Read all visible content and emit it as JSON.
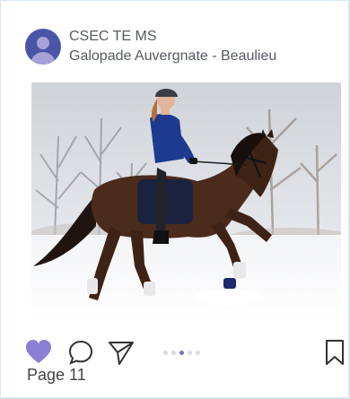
{
  "post": {
    "author": "CSEC TE MS",
    "subtitle": "Galopade Auvergnate - Beaulieu",
    "image_alt": "Rider on a bay horse trotting through snow"
  },
  "actions": {
    "like_icon": "heart-icon",
    "comment_icon": "comment-icon",
    "share_icon": "send-icon",
    "save_icon": "bookmark-icon",
    "carousel_total": 5,
    "carousel_active": 3
  },
  "footer": {
    "page_label": "Page 11"
  },
  "colors": {
    "accent": "#8a7fd4",
    "avatar": "#4a55a8",
    "text": "#555a60"
  }
}
